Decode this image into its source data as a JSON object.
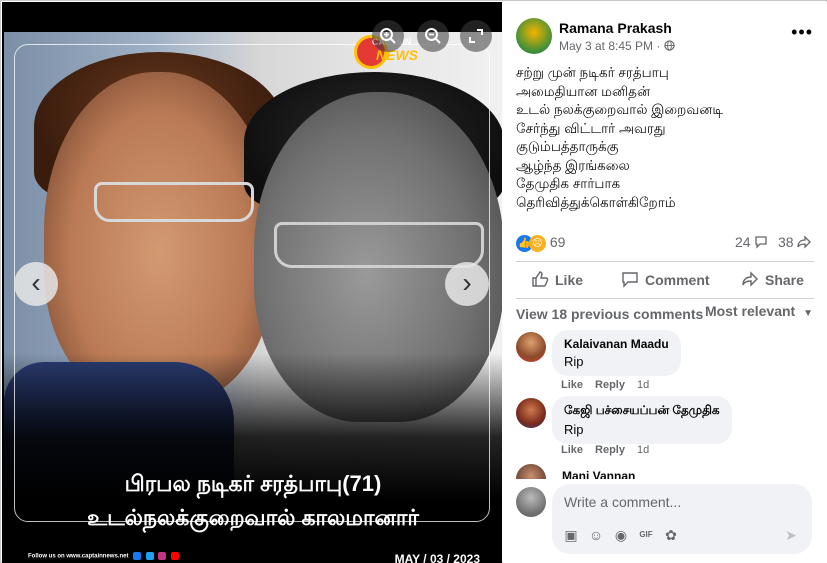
{
  "media": {
    "brand_top": "CAPTAIN",
    "brand_bottom": "NEWS",
    "headline_line1": "பிரபல நடிகர் சரத்பாபு(71)",
    "headline_line2": "உடல்நலக்குறைவால் காலமானார்",
    "footer_text": "Follow us on www.captainnews.net",
    "date_tag": "MAY / 03 / 2023",
    "icons": {
      "zoom_in": "zoom-in-icon",
      "zoom_out": "zoom-out-icon",
      "expand": "expand-icon",
      "prev": "chevron-left-icon",
      "next": "chevron-right-icon"
    }
  },
  "post": {
    "author": "Ramana Prakash",
    "timestamp": "May 3 at 8:45 PM",
    "text_lines": [
      "சற்று முன் நடிகர் சரத்பாபு",
      "அமைதியான மனிதன்",
      "உடல் நலக்குறைவால் இறைவனடி",
      "சேர்ந்து விட்டார் அவரது",
      "குடும்பத்தாருக்கு",
      "ஆழ்ந்த இரங்கலை",
      "தேமுதிக சார்பாக",
      "தெரிவித்துக்கொள்கிறோம்"
    ],
    "reaction_count": "69",
    "comment_count": "24",
    "share_count": "38"
  },
  "actions": {
    "like": "Like",
    "comment": "Comment",
    "share": "Share"
  },
  "comments_section": {
    "view_previous": "View 18 previous comments",
    "sort": "Most relevant",
    "comments": [
      {
        "name": "Kalaivanan Maadu",
        "text": "Rip",
        "like": "Like",
        "reply": "Reply",
        "time": "1d"
      },
      {
        "name": "கேஜி பச்சையப்பன் தேமுதிக",
        "text": "Rip",
        "like": "Like",
        "reply": "Reply",
        "time": "1d"
      },
      {
        "name": "Mani Vannan"
      }
    ]
  },
  "composer": {
    "placeholder": "Write a comment..."
  }
}
